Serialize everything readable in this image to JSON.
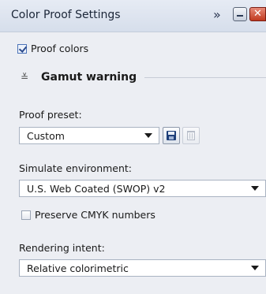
{
  "panel": {
    "title": "Color Proof Settings",
    "dock_icon": "double-chevron-right-icon",
    "minimize_icon": "minimize-icon",
    "close_icon": "close-icon",
    "close_glyph": "✕"
  },
  "proof_colors": {
    "label": "Proof colors",
    "checked": true
  },
  "gamut": {
    "title": "Gamut warning",
    "collapse_glyph": "≚",
    "collapse_icon": "collapse-chevron-icon"
  },
  "proof_preset": {
    "label": "Proof preset:",
    "value": "Custom",
    "save_icon": "save-icon",
    "delete_icon": "trash-icon"
  },
  "simulate_environment": {
    "label": "Simulate environment:",
    "value": "U.S. Web Coated (SWOP) v2"
  },
  "preserve_cmyk": {
    "label": "Preserve CMYK numbers",
    "checked": false
  },
  "rendering_intent": {
    "label": "Rendering intent:",
    "value": "Relative colorimetric"
  },
  "colors": {
    "background": "#eceef3",
    "titlebar": "#dde3ee",
    "close_button": "#c8452c",
    "save_icon": "#1e3f7a"
  }
}
